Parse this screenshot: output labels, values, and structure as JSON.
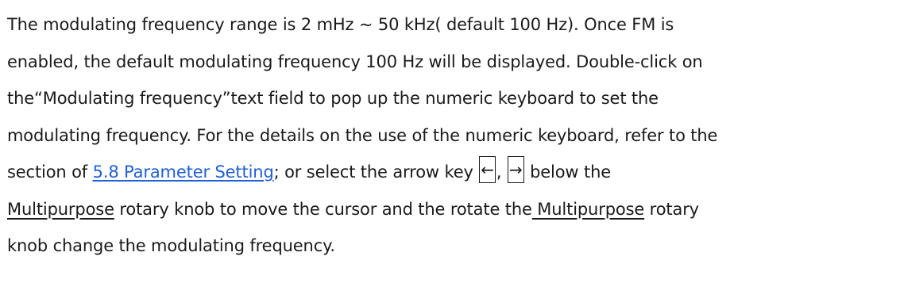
{
  "paragraph": {
    "l1": "The modulating frequency range is 2 mHz ~ 50 kHz( default 100 Hz). Once FM is",
    "l2": "enabled, the default modulating frequency 100 Hz will be displayed. Double-click on",
    "l3": "the“Modulating frequency”text field to pop up the numeric keyboard to set the",
    "l4": "modulating frequency. For the details on the use of the numeric keyboard, refer to the",
    "l5_pre": "section of ",
    "l5_link": "5.8 Parameter Setting",
    "l5_mid": "; or select the arrow key ",
    "l5_key_left": "←",
    "l5_comma": ", ",
    "l5_key_right": "→",
    "l5_post": " below the",
    "l6_knob": "Multipurpose",
    "l6_mid": " rotary knob to move the cursor and the rotate the",
    "l6_knob2": " Multipurpose",
    "l6_post": " rotary",
    "l7": "knob change the modulating frequency."
  }
}
